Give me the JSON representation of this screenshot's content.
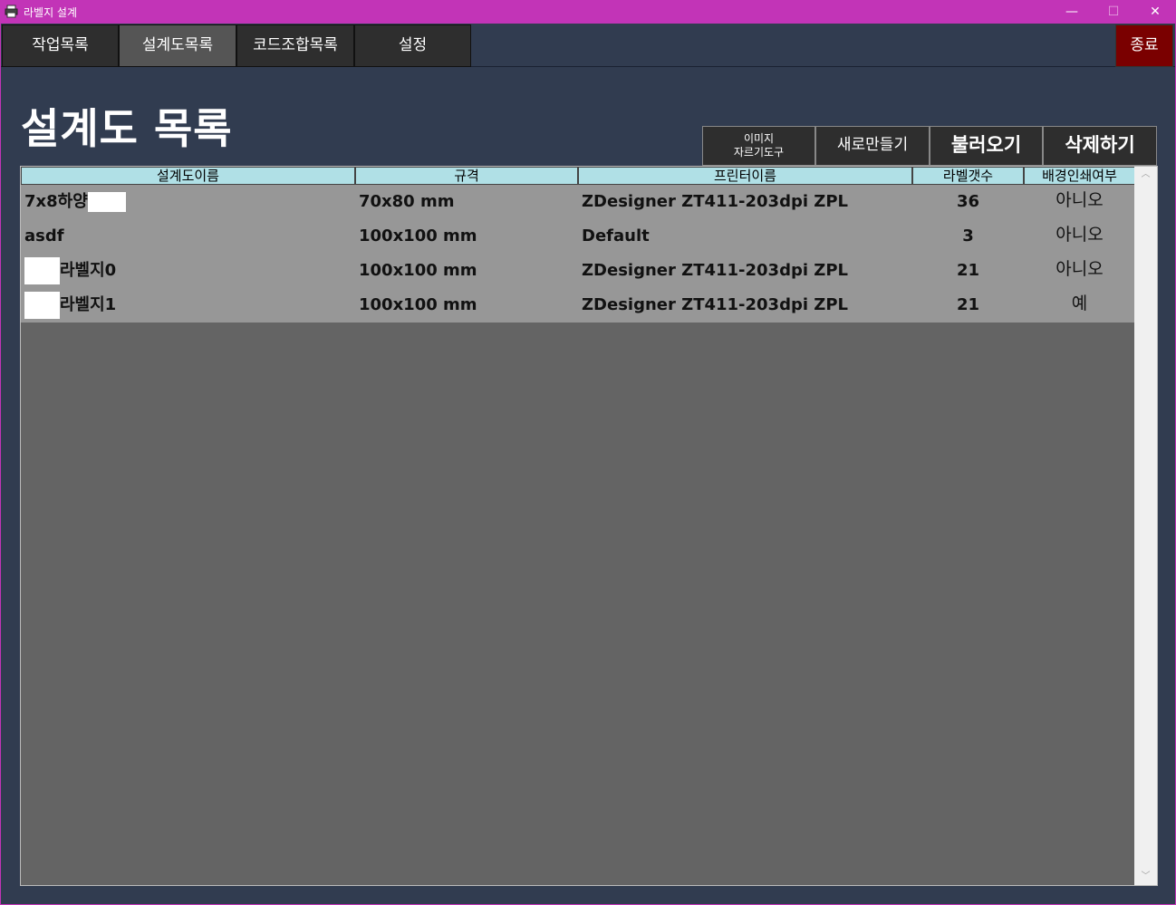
{
  "window": {
    "title": "라벨지 설계",
    "minimize": "—",
    "maximize": "☐",
    "close": "✕"
  },
  "nav": {
    "tabs": [
      "작업목록",
      "설계도목록",
      "코드조합목록",
      "설정"
    ],
    "active": 1,
    "exit_label": "종료"
  },
  "page": {
    "title": "설계도 목록"
  },
  "actions": {
    "crop_tool_line1": "이미지",
    "crop_tool_line2": "자르기도구",
    "new": "새로만들기",
    "load": "불러오기",
    "delete": "삭제하기"
  },
  "table": {
    "columns": [
      "설계도이름",
      "규격",
      "프린터이름",
      "라벨갯수",
      "배경인쇄여부"
    ],
    "rows": [
      {
        "name": "7x8하양",
        "size": "70x80 mm",
        "printer": "ZDesigner ZT411-203dpi ZPL",
        "count": "36",
        "bg_print": "아니오"
      },
      {
        "name": "asdf",
        "size": "100x100 mm",
        "printer": "Default",
        "count": "3",
        "bg_print": "아니오"
      },
      {
        "name": "라벨지0",
        "size": "100x100 mm",
        "printer": "ZDesigner ZT411-203dpi ZPL",
        "count": "21",
        "bg_print": "아니오"
      },
      {
        "name": "라벨지1",
        "size": "100x100 mm",
        "printer": "ZDesigner ZT411-203dpi ZPL",
        "count": "21",
        "bg_print": "예"
      }
    ]
  },
  "colors": {
    "titlebar": "#c234b7",
    "background": "#313c50",
    "header_cell": "#b0e0e6",
    "row_bg": "#979797",
    "grid_bg": "#646464",
    "exit_button": "#7a0000"
  },
  "icons": {
    "app": "printer-icon",
    "scroll_up": "chevron-up-icon",
    "scroll_down": "chevron-down-icon"
  }
}
